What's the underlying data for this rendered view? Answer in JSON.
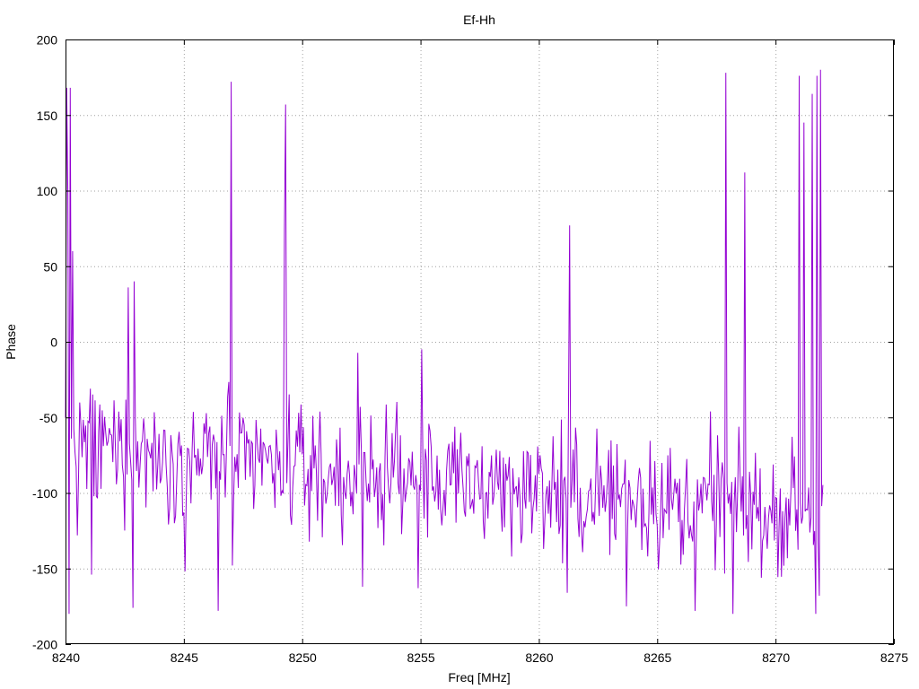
{
  "chart_data": {
    "type": "line",
    "title": "Ef-Hh",
    "xlabel": "Freq [MHz]",
    "ylabel": "Phase",
    "xlim": [
      8240,
      8275
    ],
    "ylim": [
      -200,
      200
    ],
    "xticks": [
      8240,
      8245,
      8250,
      8255,
      8260,
      8265,
      8270,
      8275
    ],
    "yticks": [
      -200,
      -150,
      -100,
      -50,
      0,
      50,
      100,
      150,
      200
    ],
    "grid": true,
    "line_color": "#9400d3",
    "series": [
      {
        "name": "",
        "x_start": 8240.0,
        "x_step": 0.05,
        "spikes": [
          {
            "x": 8240.05,
            "y": 168
          },
          {
            "x": 8240.15,
            "y": -180
          },
          {
            "x": 8240.1,
            "y": 97
          },
          {
            "x": 8240.2,
            "y": 168
          },
          {
            "x": 8240.3,
            "y": 60
          },
          {
            "x": 8240.5,
            "y": -128
          },
          {
            "x": 8241.1,
            "y": -154
          },
          {
            "x": 8242.65,
            "y": 36
          },
          {
            "x": 8242.85,
            "y": -176
          },
          {
            "x": 8242.9,
            "y": 40
          },
          {
            "x": 8246.45,
            "y": -178
          },
          {
            "x": 8247.0,
            "y": 172
          },
          {
            "x": 8247.05,
            "y": -148
          },
          {
            "x": 8249.3,
            "y": 157
          },
          {
            "x": 8249.25,
            "y": 74
          },
          {
            "x": 8252.55,
            "y": -162
          },
          {
            "x": 8254.9,
            "y": -163
          },
          {
            "x": 8255.05,
            "y": -5
          },
          {
            "x": 8261.3,
            "y": 77
          },
          {
            "x": 8261.2,
            "y": -166
          },
          {
            "x": 8263.7,
            "y": -175
          },
          {
            "x": 8266.6,
            "y": -178
          },
          {
            "x": 8267.9,
            "y": 178
          },
          {
            "x": 8268.2,
            "y": -180
          },
          {
            "x": 8268.7,
            "y": 112
          },
          {
            "x": 8271.0,
            "y": 176
          },
          {
            "x": 8271.2,
            "y": 145
          },
          {
            "x": 8271.55,
            "y": 164
          },
          {
            "x": 8271.7,
            "y": -180
          },
          {
            "x": 8271.75,
            "y": 176
          },
          {
            "x": 8271.9,
            "y": 180
          },
          {
            "x": 8271.85,
            "y": -168
          }
        ],
        "x_end": 8272.0,
        "baseline_start": -70,
        "baseline_end": -115,
        "noise_amplitude": 30
      }
    ]
  }
}
